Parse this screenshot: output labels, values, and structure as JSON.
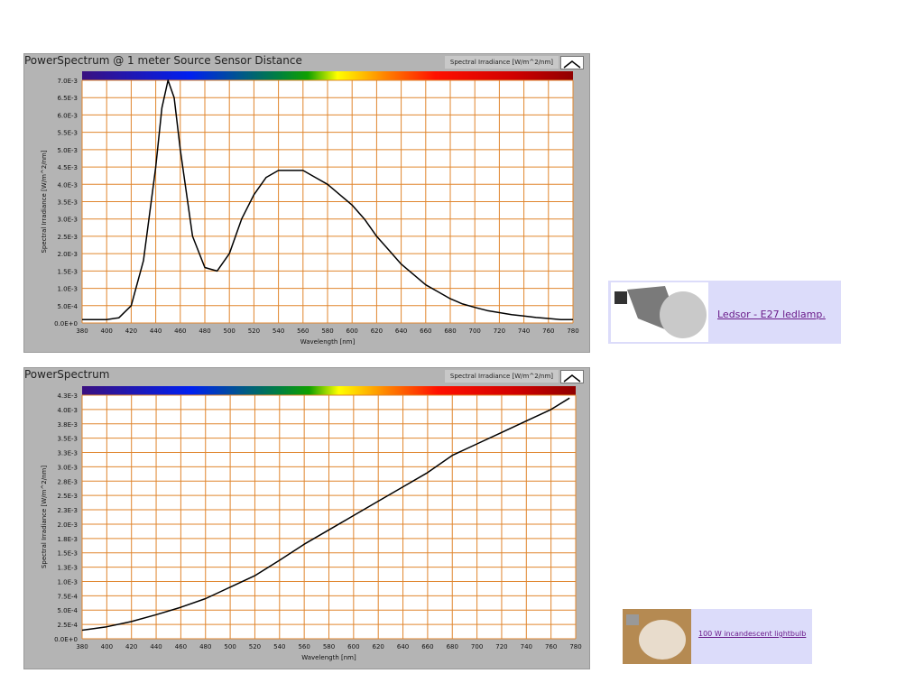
{
  "chart_data": [
    {
      "type": "line",
      "title": "PowerSpectrum @ 1 meter Source Sensor Distance",
      "legend": "Spectral Irradiance [W/m^2/nm]",
      "xlabel": "Wavelength [nm]",
      "ylabel": "Spectral Irradiance [W/m^2/nm]",
      "xlim": [
        380,
        780
      ],
      "ylim": [
        0,
        0.007
      ],
      "grid": true,
      "xticks": [
        "380",
        "400",
        "420",
        "440",
        "460",
        "480",
        "500",
        "520",
        "540",
        "560",
        "580",
        "600",
        "620",
        "640",
        "660",
        "680",
        "700",
        "720",
        "740",
        "760",
        "780"
      ],
      "yticks": [
        "0.0E+0",
        "5.0E-4",
        "1.0E-3",
        "1.5E-3",
        "2.0E-3",
        "2.5E-3",
        "3.0E-3",
        "3.5E-3",
        "4.0E-3",
        "4.5E-3",
        "5.0E-3",
        "5.5E-3",
        "6.0E-3",
        "6.5E-3",
        "7.0E-3"
      ],
      "x": [
        380,
        390,
        400,
        410,
        420,
        430,
        440,
        445,
        450,
        455,
        460,
        470,
        480,
        490,
        500,
        510,
        520,
        530,
        540,
        550,
        560,
        570,
        580,
        590,
        600,
        610,
        620,
        630,
        640,
        650,
        660,
        670,
        680,
        690,
        700,
        710,
        720,
        730,
        740,
        750,
        760,
        770,
        780
      ],
      "y": [
        0.0001,
        0.0001,
        0.0001,
        0.00015,
        0.0005,
        0.0018,
        0.0045,
        0.0062,
        0.007,
        0.0065,
        0.005,
        0.0025,
        0.0016,
        0.0015,
        0.002,
        0.003,
        0.0037,
        0.0042,
        0.0044,
        0.0044,
        0.0044,
        0.0042,
        0.004,
        0.0037,
        0.0034,
        0.003,
        0.0025,
        0.0021,
        0.0017,
        0.0014,
        0.0011,
        0.0009,
        0.0007,
        0.00055,
        0.00045,
        0.00036,
        0.0003,
        0.00024,
        0.0002,
        0.00016,
        0.00013,
        0.0001,
        0.0001
      ]
    },
    {
      "type": "line",
      "title": "PowerSpectrum",
      "legend": "Spectral Irradiance [W/m^2/nm]",
      "xlabel": "Wavelength [nm]",
      "ylabel": "Spectral Irradiance [W/m^2/nm]",
      "xlim": [
        380,
        780
      ],
      "ylim": [
        0,
        0.00425
      ],
      "grid": true,
      "xticks": [
        "380",
        "400",
        "420",
        "440",
        "460",
        "480",
        "500",
        "520",
        "540",
        "560",
        "580",
        "600",
        "620",
        "640",
        "660",
        "680",
        "700",
        "720",
        "740",
        "760",
        "780"
      ],
      "yticks": [
        "0.0E+0",
        "2.5E-4",
        "5.0E-4",
        "7.5E-4",
        "1.0E-3",
        "1.3E-3",
        "1.5E-3",
        "1.8E-3",
        "2.0E-3",
        "2.3E-3",
        "2.5E-3",
        "2.8E-3",
        "3.0E-3",
        "3.3E-3",
        "3.5E-3",
        "3.8E-3",
        "4.0E-3",
        "4.3E-3"
      ],
      "x": [
        380,
        390,
        400,
        420,
        440,
        460,
        480,
        500,
        520,
        540,
        560,
        580,
        600,
        620,
        640,
        660,
        680,
        700,
        720,
        740,
        760,
        775
      ],
      "y": [
        0.00015,
        0.00018,
        0.00021,
        0.0003,
        0.00042,
        0.00055,
        0.0007,
        0.0009,
        0.0011,
        0.00137,
        0.00165,
        0.0019,
        0.00215,
        0.0024,
        0.00265,
        0.0029,
        0.0032,
        0.0034,
        0.0036,
        0.0038,
        0.004,
        0.0042
      ]
    }
  ],
  "colors": {
    "grid": "#e0862e",
    "panel": "#b4b4b4",
    "line": "#000000",
    "link": "#6a1b8a",
    "card": "#dcdcfa"
  },
  "links": {
    "led": "Ledsor - E27 ledlamp.",
    "incandescent": "100 W incandescent lightbulb"
  }
}
